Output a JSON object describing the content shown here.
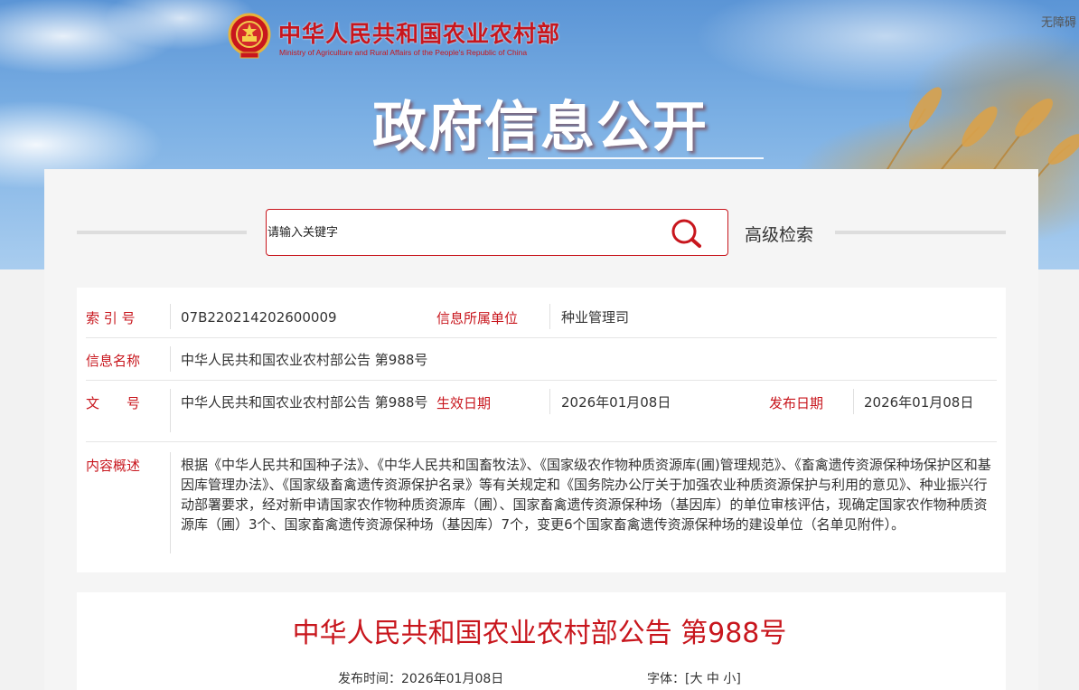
{
  "header": {
    "ministry_name_cn": "中华人民共和国农业农村部",
    "ministry_name_en": "Ministry of Agriculture and Rural Affairs of the People's Republic of China",
    "accessibility_label": "无障碍",
    "banner_title": "政府信息公开"
  },
  "search": {
    "placeholder": "请输入关键字",
    "advanced_label": "高级检索",
    "icon": "search-icon"
  },
  "info": {
    "index_label": "索 引 号",
    "index_value": "07B220214202600009",
    "department_label": "信息所属单位",
    "department_value": "种业管理司",
    "name_label": "信息名称",
    "name_value": "中华人民共和国农业农村部公告 第988号",
    "doc_no_label": "文　　号",
    "doc_no_value": "中华人民共和国农业农村部公告 第988号",
    "effective_label": "生效日期",
    "effective_value": "2026年01月08日",
    "publish_label": "发布日期",
    "publish_value": "2026年01月08日",
    "summary_label": "内容概述",
    "summary_value": "根据《中华人民共和国种子法》、《中华人民共和国畜牧法》、《国家级农作物种质资源库(圃)管理规范》、《畜禽遗传资源保种场保护区和基因库管理办法》、《国家级畜禽遗传资源保护名录》等有关规定和《国务院办公厅关于加强农业种质资源保护与利用的意见》、种业振兴行动部署要求，经对新申请国家农作物种质资源库（圃）、国家畜禽遗传资源保种场（基因库）的单位审核评估，现确定国家农作物种质资源库（圃）3个、国家畜禽遗传资源保种场（基因库）7个，变更6个国家畜禽遗传资源保种场的建设单位（名单见附件）。"
  },
  "article": {
    "title": "中华人民共和国农业农村部公告 第988号",
    "publish_time_label": "发布时间：",
    "publish_time_value": "2026年01月08日",
    "font_label": "字体：",
    "font_open": "[",
    "font_large": "大",
    "font_medium": "中",
    "font_small": "小",
    "font_close": "]"
  },
  "colors": {
    "accent": "#c8161d",
    "text": "#333333"
  }
}
